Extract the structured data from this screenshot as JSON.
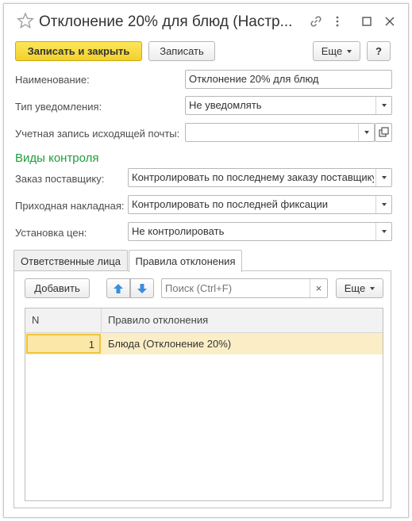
{
  "window": {
    "title": "Отклонение 20% для блюд (Настр..."
  },
  "toolbar": {
    "save_close_label": "Записать и закрыть",
    "save_label": "Записать",
    "more_label": "Еще",
    "help_label": "?"
  },
  "form": {
    "name_label": "Наименование:",
    "name_value": "Отклонение 20% для блюд",
    "notify_type_label": "Тип уведомления:",
    "notify_type_value": "Не уведомлять",
    "mail_account_label": "Учетная запись исходящей почты:",
    "mail_account_value": ""
  },
  "control": {
    "section_title": "Виды контроля",
    "supplier_order_label": "Заказ поставщику:",
    "supplier_order_value": "Контролировать по последнему заказу поставщику",
    "receipt_label": "Приходная накладная:",
    "receipt_value": "Контролировать по последней фиксации",
    "price_setting_label": "Установка цен:",
    "price_setting_value": "Не контролировать"
  },
  "tabs": [
    {
      "label": "Ответственные лица",
      "active": false
    },
    {
      "label": "Правила отклонения",
      "active": true
    }
  ],
  "table_toolbar": {
    "add_label": "Добавить",
    "search_placeholder": "Поиск (Ctrl+F)",
    "clear_label": "×",
    "more_label": "Еще"
  },
  "table": {
    "columns": [
      "N",
      "Правило отклонения"
    ],
    "rows": [
      {
        "n": "1",
        "rule": "Блюда (Отклонение 20%)"
      }
    ]
  },
  "colors": {
    "accent_yellow": "#f5d83a",
    "section_green": "#1e9e3c",
    "selected_row": "#fbeec6",
    "arrow_blue": "#3b8ede"
  }
}
